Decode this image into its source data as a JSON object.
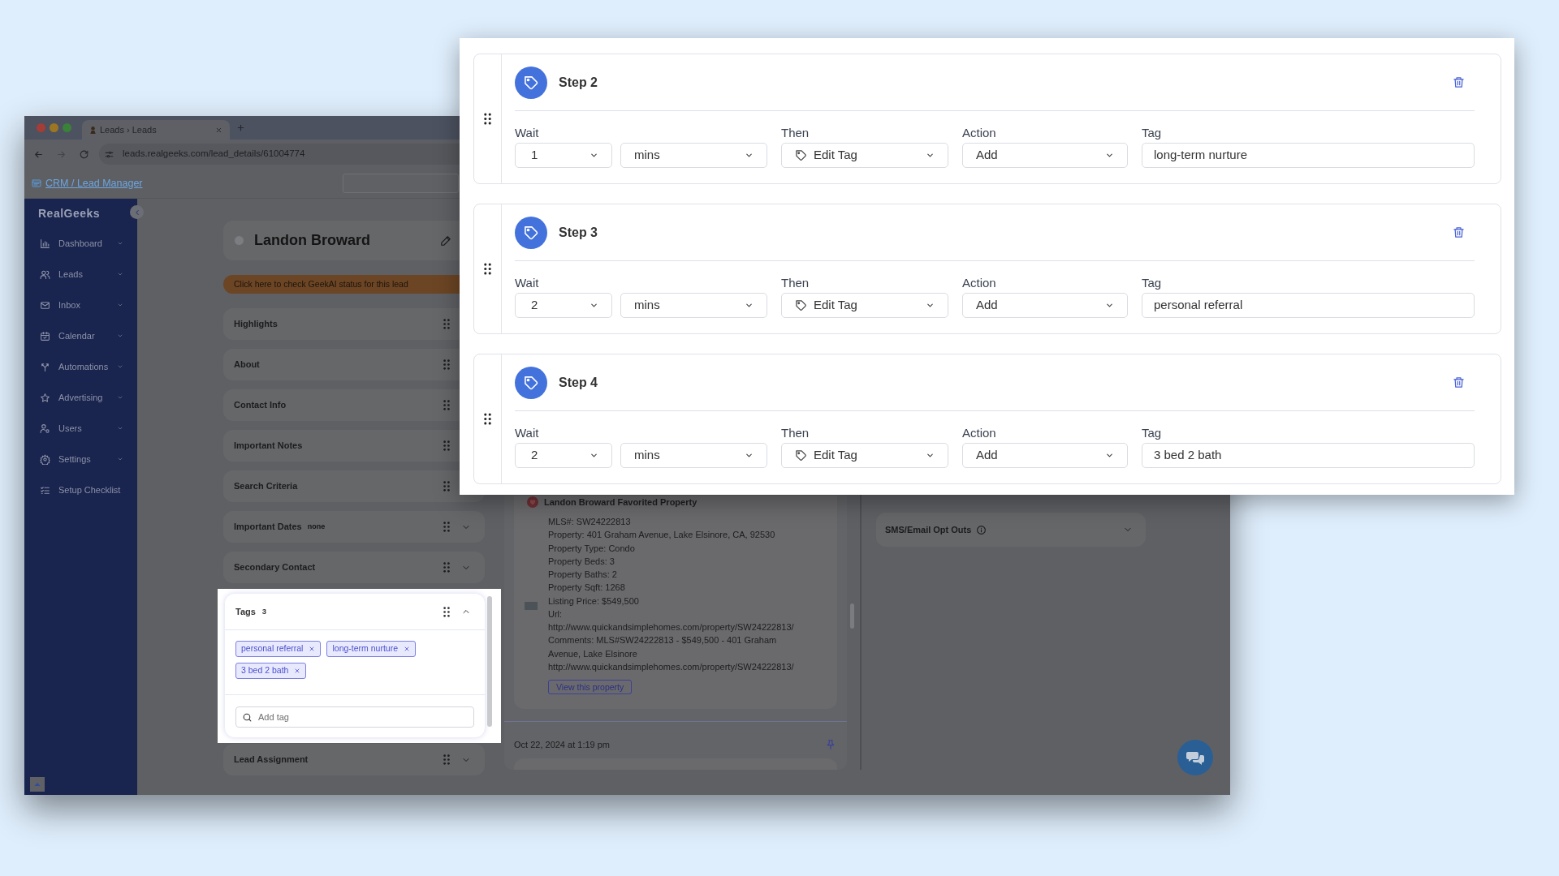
{
  "browser": {
    "tab_title": "Leads › Leads",
    "url": "leads.realgeeks.com/lead_details/61004774",
    "breadcrumb": "CRM / Lead Manager"
  },
  "sidebar": {
    "logo": "RealGeeks",
    "items": [
      {
        "label": "Dashboard",
        "expandable": true
      },
      {
        "label": "Leads",
        "expandable": true
      },
      {
        "label": "Inbox",
        "expandable": true
      },
      {
        "label": "Calendar",
        "expandable": true
      },
      {
        "label": "Automations",
        "expandable": true
      },
      {
        "label": "Advertising",
        "expandable": true
      },
      {
        "label": "Users",
        "expandable": true
      },
      {
        "label": "Settings",
        "expandable": true
      },
      {
        "label": "Setup Checklist",
        "expandable": false
      }
    ]
  },
  "lead": {
    "name": "Landon Broward",
    "banner": "Click here to check GeekAI status for this lead",
    "sections": [
      {
        "title": "Highlights",
        "highlighted": false
      },
      {
        "title": "About",
        "highlighted": false
      },
      {
        "title": "Contact Info",
        "highlighted": false
      },
      {
        "title": "Important Notes",
        "highlighted": false
      },
      {
        "title": "Search Criteria",
        "highlighted": false
      },
      {
        "title": "Important Dates",
        "note": "none",
        "expanded": false,
        "highlighted": false
      },
      {
        "title": "Secondary Contact",
        "expanded": false,
        "highlighted": false
      },
      {
        "title": "Tags",
        "count": "3",
        "expanded": true,
        "highlighted": true,
        "tags": [
          "personal referral",
          "long-term nurture",
          "3 bed 2 bath"
        ],
        "add_placeholder": "Add tag"
      },
      {
        "title": "Lead Assignment",
        "expanded": false,
        "highlighted": false
      }
    ]
  },
  "activity": {
    "title": "Landon Broward Favorited Property",
    "details": [
      "MLS#: SW24222813",
      "Property: 401 Graham Avenue, Lake Elsinore, CA, 92530",
      "Property Type: Condo",
      "Property Beds: 3",
      "Property Baths: 2",
      "Property Sqft: 1268",
      "Listing Price: $549,500",
      "Url:",
      "http://www.quickandsimplehomes.com/property/SW24222813/",
      "Comments: MLS#SW24222813 - $549,500 - 401 Graham Avenue, Lake Elsinore",
      "http://www.quickandsimplehomes.com/property/SW24222813/"
    ],
    "button": "View this property",
    "timestamp": "Oct 22, 2024 at 1:19 pm"
  },
  "side_panel": {
    "title": "SMS/Email Opt Outs",
    "expanded": false
  },
  "modal": {
    "steps": [
      {
        "title": "Step 2",
        "wait": {
          "label": "Wait",
          "amount": "1",
          "unit": "mins"
        },
        "then": {
          "label": "Then",
          "value": "Edit Tag"
        },
        "action": {
          "label": "Action",
          "value": "Add"
        },
        "tag": {
          "label": "Tag",
          "value": "long-term nurture"
        }
      },
      {
        "title": "Step 3",
        "wait": {
          "label": "Wait",
          "amount": "2",
          "unit": "mins"
        },
        "then": {
          "label": "Then",
          "value": "Edit Tag"
        },
        "action": {
          "label": "Action",
          "value": "Add"
        },
        "tag": {
          "label": "Tag",
          "value": "personal referral"
        }
      },
      {
        "title": "Step 4",
        "wait": {
          "label": "Wait",
          "amount": "2",
          "unit": "mins"
        },
        "then": {
          "label": "Then",
          "value": "Edit Tag"
        },
        "action": {
          "label": "Action",
          "value": "Add"
        },
        "tag": {
          "label": "Tag",
          "value": "3 bed 2 bath"
        }
      }
    ]
  }
}
